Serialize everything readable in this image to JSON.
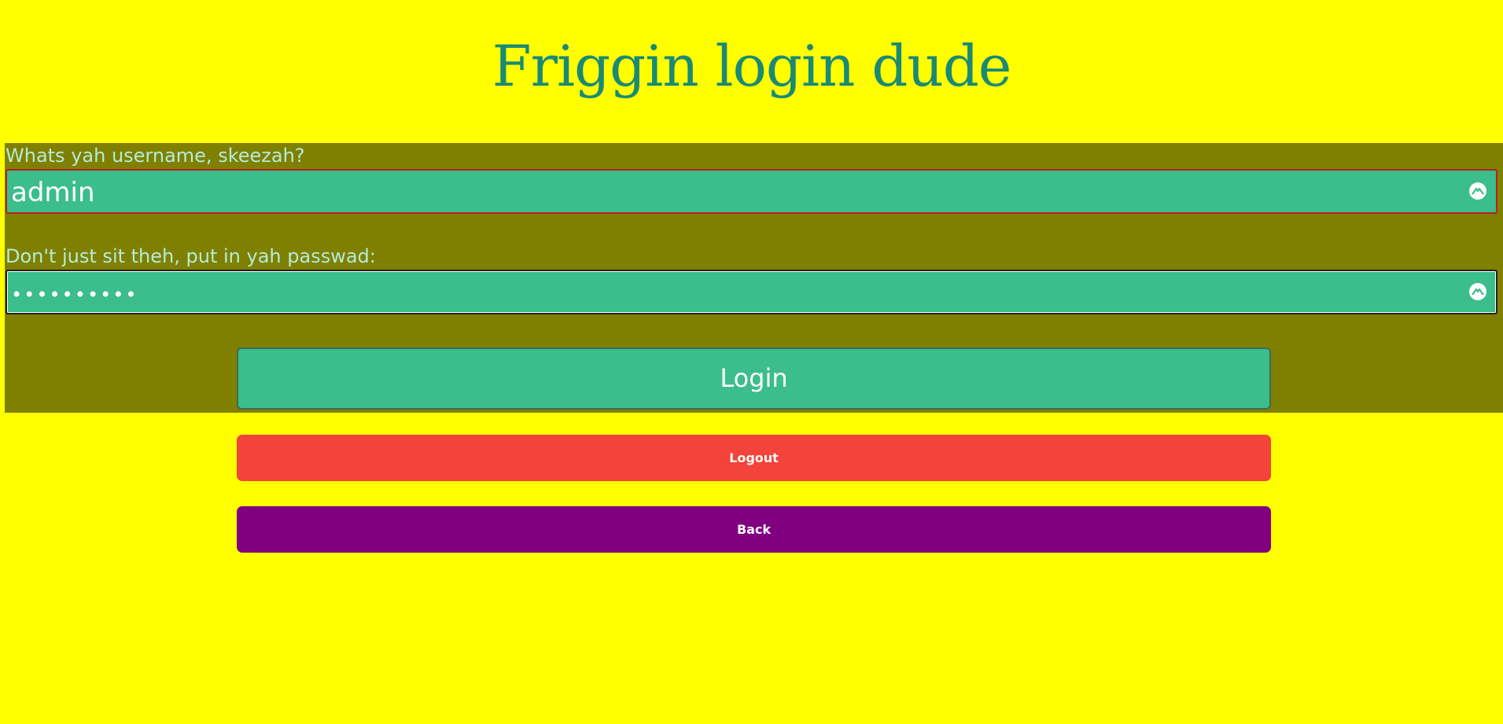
{
  "header": {
    "title": "Friggin login dude"
  },
  "login_form": {
    "username_label": "Whats yah username, skeezah?",
    "username_value": "admin",
    "username_icon": "clear-icon",
    "password_label": "Don't just sit theh, put in yah passwad:",
    "password_value": "••••••••••",
    "password_icon": "clear-icon",
    "login_label": "Login"
  },
  "actions": {
    "logout_label": "Logout",
    "back_label": "Back"
  },
  "colors": {
    "page_background": "#ffff00",
    "panel_background": "#808000",
    "title": "#1a8a73",
    "field_background": "#3bbd8c",
    "label_text": "#b3ecd8",
    "logout": "#f4433a",
    "back": "#800080"
  }
}
